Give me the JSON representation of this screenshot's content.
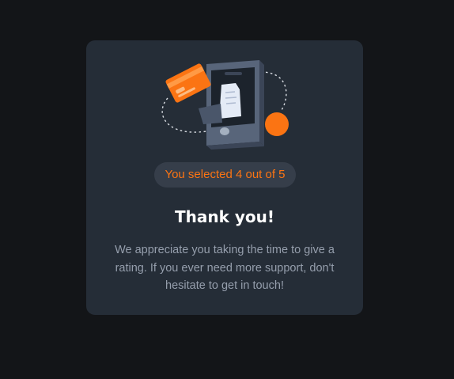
{
  "thank_you_card": {
    "selection_text": "You selected 4 out of 5",
    "title": "Thank you!",
    "message": "We appreciate you taking the time to give a rating. If you ever need more support, don't hesitate to get in touch!",
    "rating": 4,
    "max_rating": 5
  },
  "colors": {
    "page_background": "#131518",
    "card_background": "#252d37",
    "accent": "#fb7413",
    "title_text": "#ffffff",
    "body_text": "#959eac",
    "pill_background": "#363e4a"
  },
  "icons": {
    "illustration": "phone-payment-illustration"
  }
}
